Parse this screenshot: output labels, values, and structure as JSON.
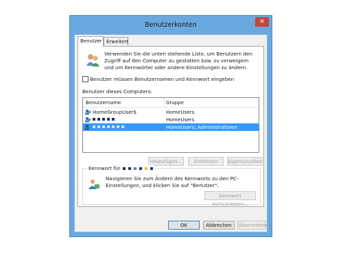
{
  "window": {
    "title": "Benutzerkonten",
    "close_symbol": "✕"
  },
  "tabs": [
    {
      "label": "Benutzer",
      "active": true
    },
    {
      "label": "Erweitert",
      "active": false
    }
  ],
  "intro_text": "Verwenden Sie die unten stehende Liste, um Benutzern den Zugriff auf den Computer zu gestatten bzw. zu verweigern und um Kennwörter oder andere Einstellungen zu ändern.",
  "require_password": {
    "label": "Benutzer müssen Benutzernamen und Kennwort eingeben",
    "checked": false
  },
  "users_section_label": "Benutzer dieses Computers:",
  "user_list": {
    "columns": {
      "name": "Benutzername",
      "group": "Gruppe"
    },
    "rows": [
      {
        "name": "HomeGroupUser$",
        "group": "HomeUsers",
        "redacted": false,
        "selected": false
      },
      {
        "name": "",
        "group": "HomeUsers",
        "redacted": true,
        "selected": false
      },
      {
        "name": "",
        "group": "HomeUsers; Administratoren",
        "redacted": true,
        "selected": true
      }
    ]
  },
  "list_buttons": {
    "add": "Hinzufügen...",
    "remove": "Entfernen",
    "properties": "Eigenschaften"
  },
  "password_group": {
    "title_prefix": "Kennwort für",
    "text": "Navigieren Sie zum Ändern des Kennworts zu den PC-Einstellungen, und klicken Sie auf \"Benutzer\".",
    "reset_button": "Kennwort zurücksetzen..."
  },
  "dialog_buttons": {
    "ok": "OK",
    "cancel": "Abbrechen",
    "apply": "Übernehmen"
  },
  "colors": {
    "window_frame": "#6aa8e0",
    "close_button": "#c7433b",
    "selection": "#3399ff"
  }
}
